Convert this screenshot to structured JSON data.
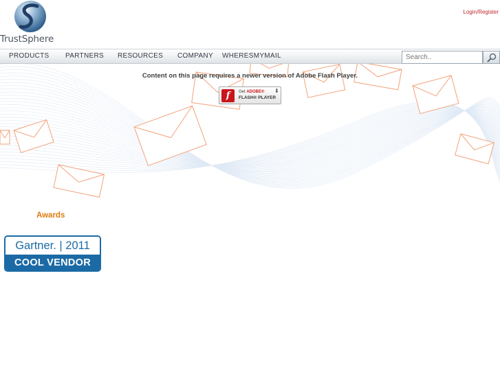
{
  "header": {
    "logo_text": "TrustSphere",
    "login_label": "Login/Register"
  },
  "nav": {
    "items": [
      {
        "label": "PRODUCTS"
      },
      {
        "label": "PARTNERS"
      },
      {
        "label": "RESOURCES"
      },
      {
        "label": "COMPANY"
      },
      {
        "label": "WHERESMYMAIL"
      }
    ]
  },
  "search": {
    "placeholder": "Search.."
  },
  "flash": {
    "message": "Content on this page requires a newer version of Adobe Flash Player.",
    "badge_get": "Get",
    "badge_adobe": "ADOBE®",
    "badge_player": "FLASH® PLAYER"
  },
  "awards": {
    "title": "Awards",
    "badge_top": "Gartner. | 2011",
    "badge_bottom": "COOL VENDOR"
  },
  "colors": {
    "brand_blue": "#1b6aa5",
    "awards_orange": "#e07b10",
    "login_red": "#c0272d",
    "envelope_orange": "#f2a27a"
  }
}
